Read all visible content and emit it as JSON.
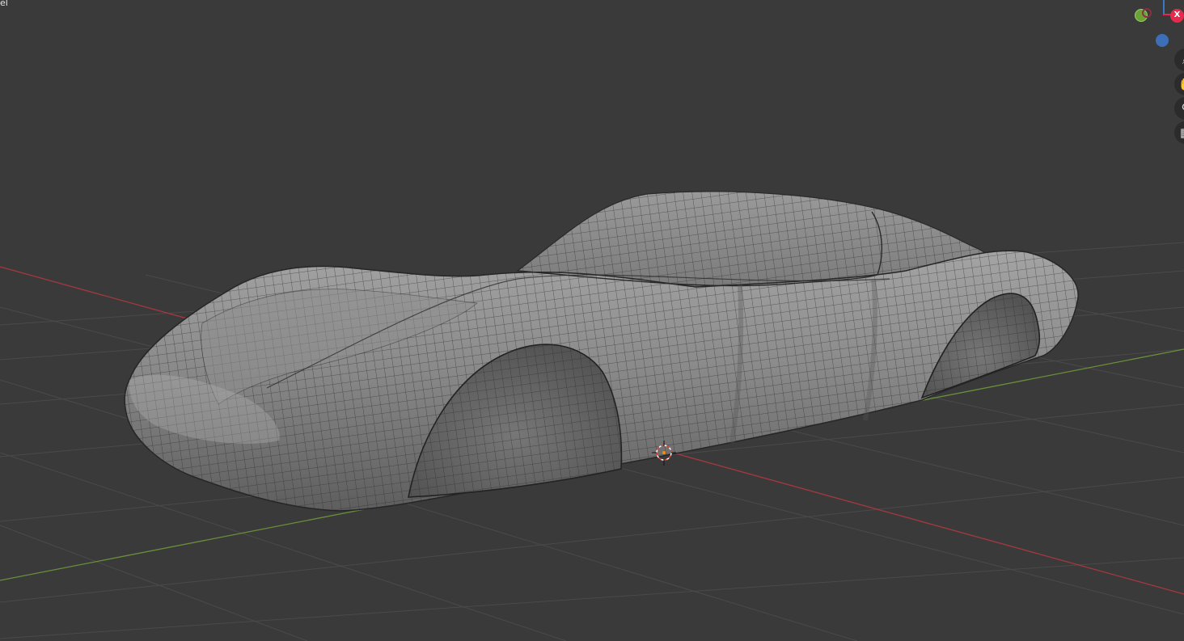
{
  "viewport": {
    "label": "el"
  },
  "gizmo": {
    "x_axis_label": "X",
    "colors": {
      "x": "#e8294e",
      "y": "#6ca138",
      "z": "#3d75c7",
      "background": "#393939",
      "grid": "#4a4a4a",
      "x_line": "#a6383f",
      "y_line": "#6a8f3a"
    }
  },
  "nav_buttons": [
    {
      "name": "zoom-icon",
      "glyph": "⌕"
    },
    {
      "name": "pan-hand-icon",
      "glyph": "✋"
    },
    {
      "name": "camera-icon",
      "glyph": "⚲"
    },
    {
      "name": "orthographic-grid-icon",
      "glyph": "▦"
    }
  ]
}
